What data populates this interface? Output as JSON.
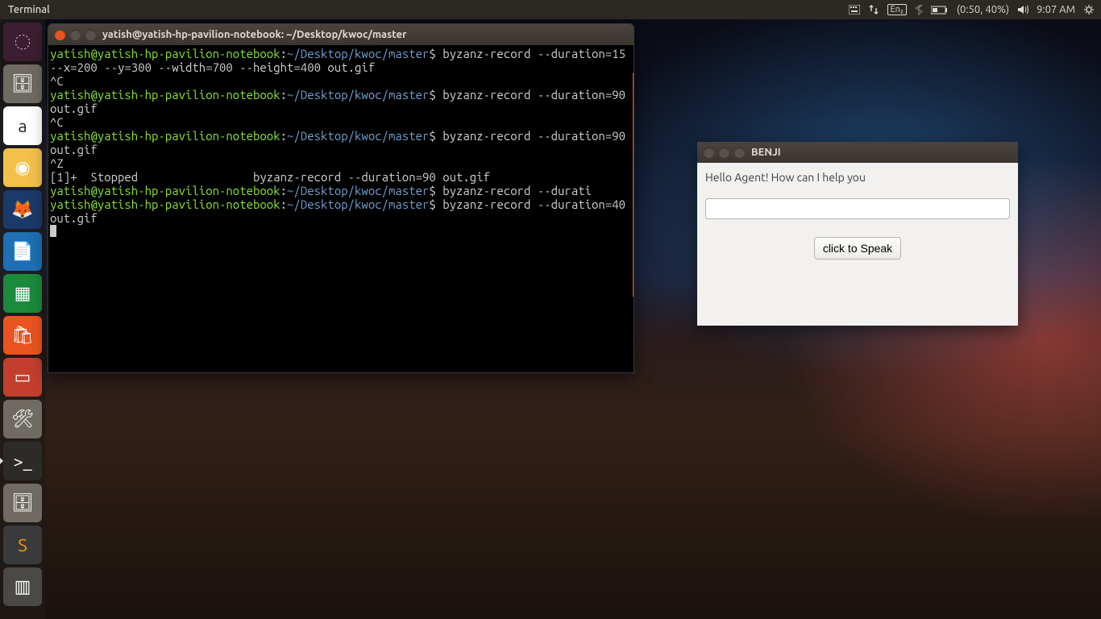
{
  "menubar": {
    "title": "Terminal",
    "tray": {
      "keyboard": "En₂",
      "battery": "(0:50, 40%)",
      "clock": "9:07 AM"
    }
  },
  "launcher": {
    "items": [
      {
        "name": "dash",
        "bg": "#3b1f30",
        "glyph": "◌",
        "tip": "Dash"
      },
      {
        "name": "files",
        "bg": "#6f6a62",
        "glyph": "🗄",
        "tip": "Files"
      },
      {
        "name": "amazon",
        "bg": "#ffffff",
        "glyph": "a",
        "tip": "Amazon",
        "fg": "#222"
      },
      {
        "name": "chrome",
        "bg": "#f3c14b",
        "glyph": "◉",
        "tip": "Chrome"
      },
      {
        "name": "firefox",
        "bg": "#1b3a6b",
        "glyph": "🦊",
        "tip": "Firefox"
      },
      {
        "name": "writer",
        "bg": "#1e6fb3",
        "glyph": "📄",
        "tip": "LibreOffice Writer"
      },
      {
        "name": "calc",
        "bg": "#1b8a3d",
        "glyph": "▦",
        "tip": "LibreOffice Calc"
      },
      {
        "name": "software",
        "bg": "#e95420",
        "glyph": "🛍",
        "tip": "Ubuntu Software"
      },
      {
        "name": "impress",
        "bg": "#c23f2e",
        "glyph": "▭",
        "tip": "LibreOffice Impress"
      },
      {
        "name": "settings",
        "bg": "#6f6a62",
        "glyph": "🛠",
        "tip": "Settings"
      },
      {
        "name": "terminal",
        "bg": "#2d2b28",
        "glyph": ">_",
        "tip": "Terminal",
        "active": true
      },
      {
        "name": "files2",
        "bg": "#6f6a62",
        "glyph": "🗄",
        "tip": "Files"
      },
      {
        "name": "sublime",
        "bg": "#3a3a3a",
        "glyph": "S",
        "tip": "Sublime Text",
        "fg": "#f59e0b"
      },
      {
        "name": "workspace",
        "bg": "#4a4946",
        "glyph": "▥",
        "tip": "Workspace Switcher"
      }
    ]
  },
  "terminal": {
    "title": "yatish@yatish-hp-pavilion-notebook: ~/Desktop/kwoc/master",
    "user": "yatish@yatish-hp-pavilion-notebook",
    "path": "~/Desktop/kwoc/master",
    "lines": [
      {
        "cmd": "byzanz-record --duration=15 --x=200 --y=300 --width=700 --height=400 out.gif"
      },
      {
        "raw": "^C"
      },
      {
        "cmd": "byzanz-record --duration=90 out.gif"
      },
      {
        "raw": "^C"
      },
      {
        "cmd": "byzanz-record --duration=90 out.gif"
      },
      {
        "raw": "^Z"
      },
      {
        "raw": "[1]+  Stopped                 byzanz-record --duration=90 out.gif"
      },
      {
        "cmd": "byzanz-record --durati"
      },
      {
        "cmd": "byzanz-record --duration=40 out.gif"
      }
    ]
  },
  "benji": {
    "title": "BENJI",
    "greeting": "Hello Agent! How can I help you",
    "input_value": "",
    "speak_label": "click to Speak"
  }
}
